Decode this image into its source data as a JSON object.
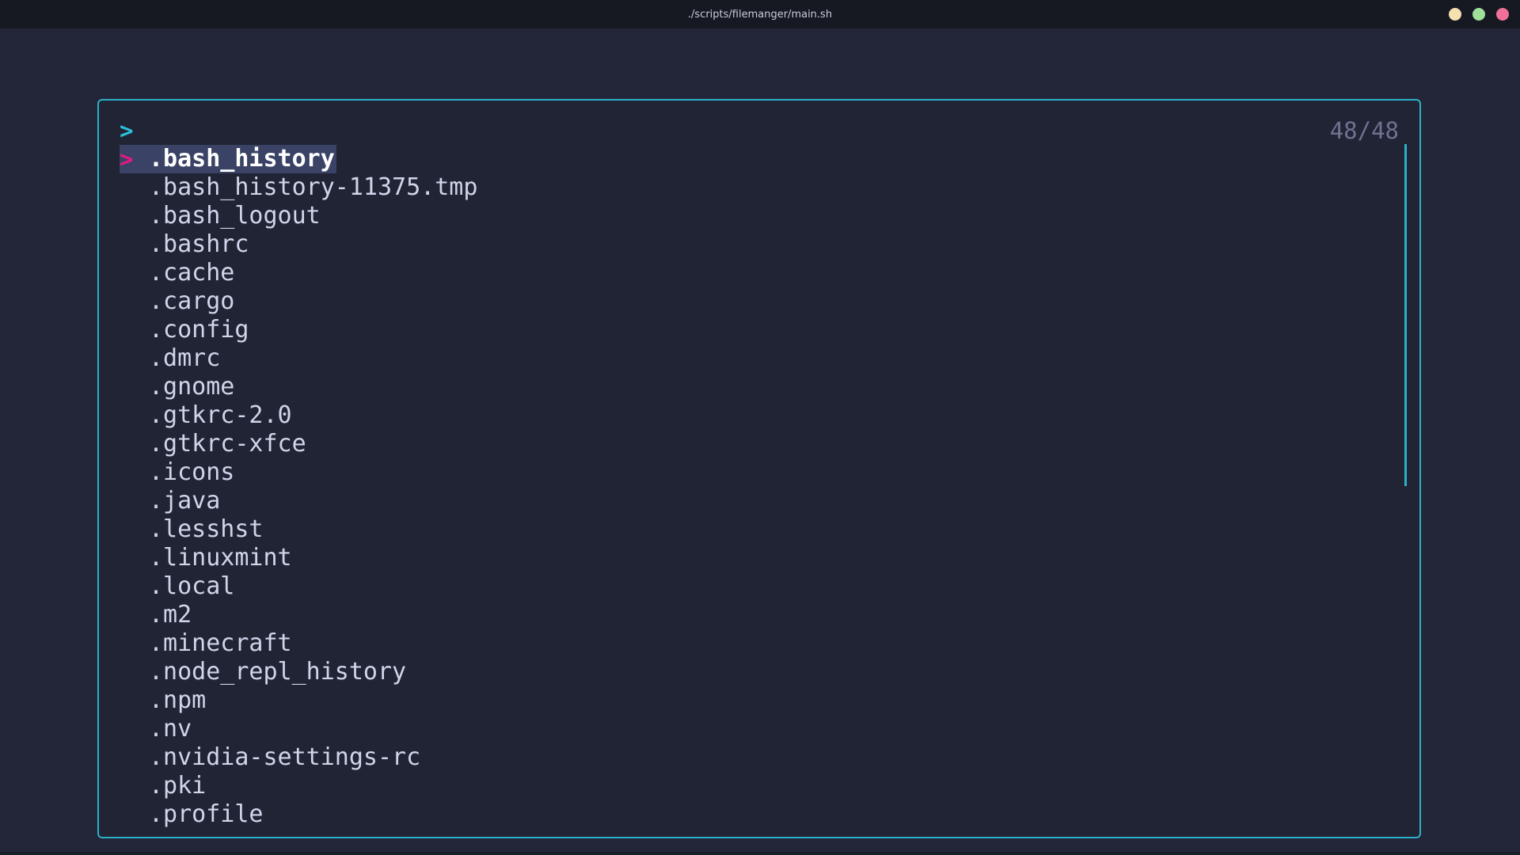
{
  "window": {
    "title": "./scripts/filemanger/main.sh",
    "buttons": [
      {
        "name": "minimize",
        "color": "#f5e0b0"
      },
      {
        "name": "maximize",
        "color": "#9fe09a"
      },
      {
        "name": "close",
        "color": "#f0709a"
      }
    ]
  },
  "finder": {
    "prompt": ">",
    "query": "",
    "counter": "48/48",
    "pointer": ">",
    "selected_index": 0,
    "items": [
      ".bash_history",
      ".bash_history-11375.tmp",
      ".bash_logout",
      ".bashrc",
      ".cache",
      ".cargo",
      ".config",
      ".dmrc",
      ".gnome",
      ".gtkrc-2.0",
      ".gtkrc-xfce",
      ".icons",
      ".java",
      ".lesshst",
      ".linuxmint",
      ".local",
      ".m2",
      ".minecraft",
      ".node_repl_history",
      ".npm",
      ".nv",
      ".nvidia-settings-rc",
      ".pki",
      ".profile"
    ]
  },
  "colors": {
    "border": "#2cb0c7",
    "pointer": "#e5197e",
    "selection_bg": "#3a4366"
  }
}
